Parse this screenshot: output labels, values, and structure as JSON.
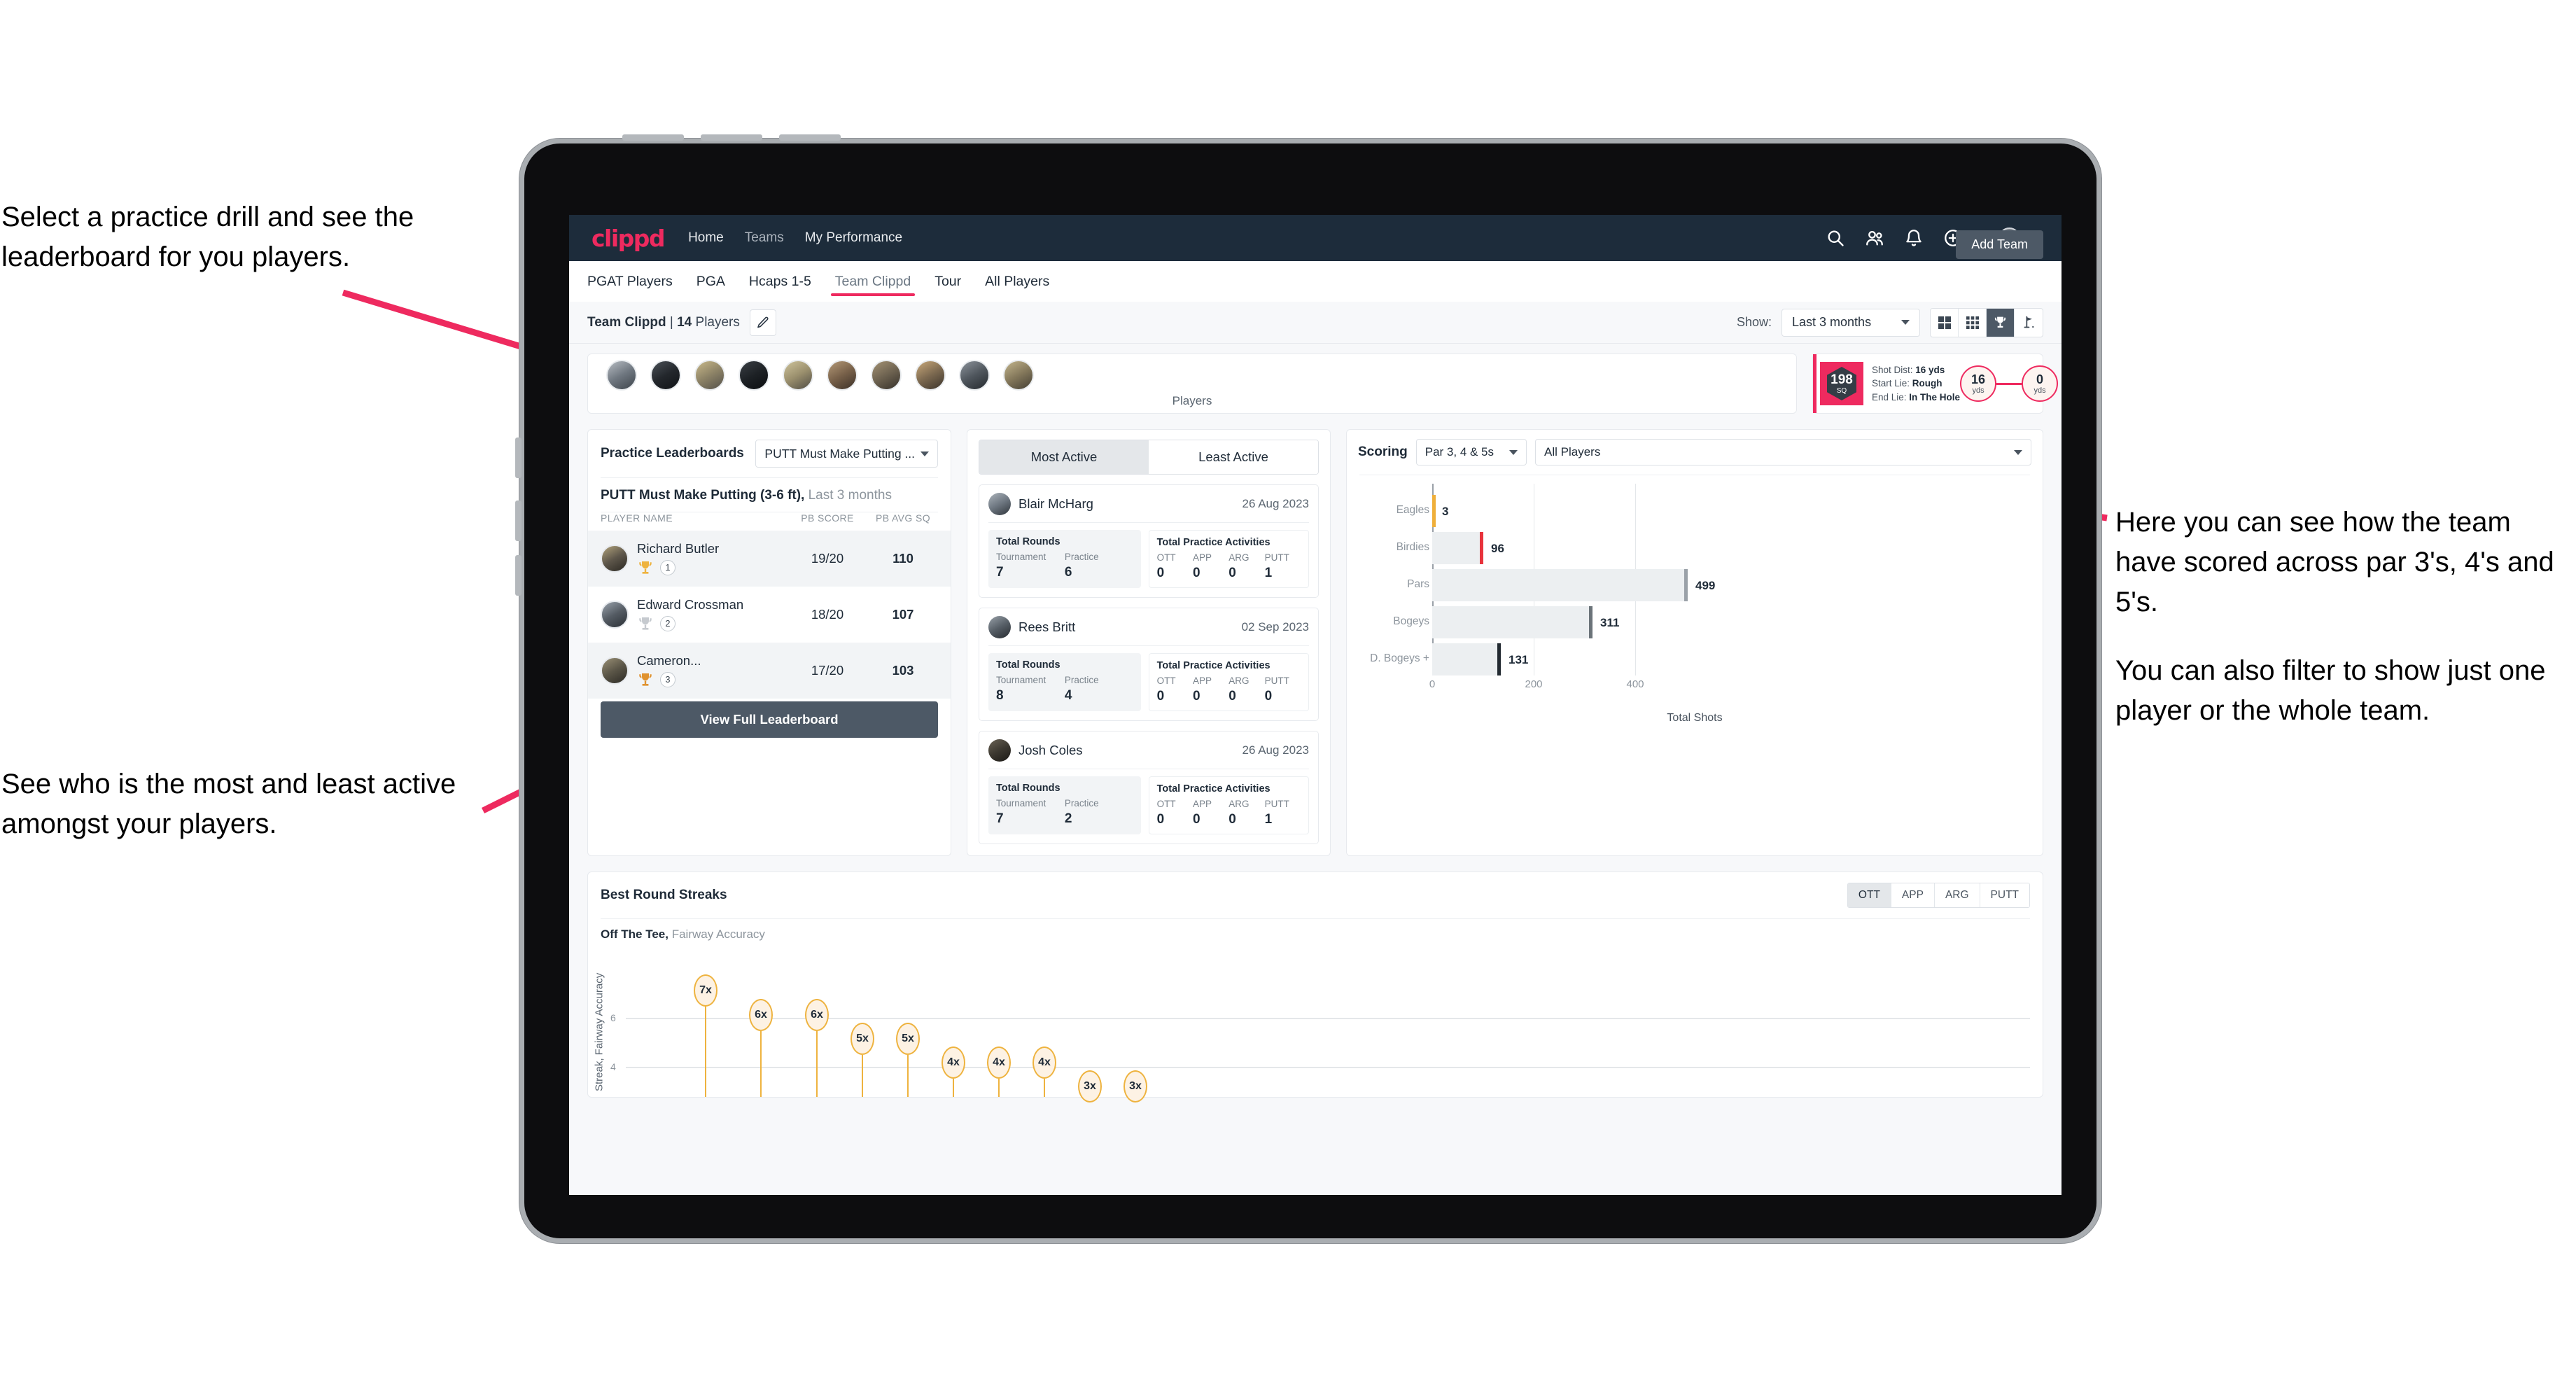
{
  "annotations": {
    "top_left": "Select a practice drill and see the leaderboard for you players.",
    "bottom_left": "See who is the most and least active amongst your players.",
    "right_1": "Here you can see how the team have scored across par 3's, 4's and 5's.",
    "right_2": "You can also filter to show just one player or the whole team."
  },
  "app": {
    "logo": "clippd",
    "nav": [
      {
        "label": "Home",
        "dim": false
      },
      {
        "label": "Teams",
        "dim": true
      },
      {
        "label": "My Performance",
        "dim": false
      }
    ],
    "header_icons": [
      "search-icon",
      "people-icon",
      "bell-icon",
      "plus-circle-icon",
      "avatar"
    ]
  },
  "tabs": [
    {
      "label": "PGAT Players",
      "active": false
    },
    {
      "label": "PGA",
      "active": false
    },
    {
      "label": "Hcaps 1-5",
      "active": false
    },
    {
      "label": "Team Clippd",
      "active": true
    },
    {
      "label": "Tour",
      "active": false
    },
    {
      "label": "All Players",
      "active": false
    }
  ],
  "add_team_button": "Add Team",
  "subbar": {
    "team_name": "Team Clippd",
    "separator": " | ",
    "player_count": "14",
    "players_word": " Players",
    "edit_icon": "pencil-icon",
    "show_label": "Show:",
    "period_value": "Last 3 months",
    "view_buttons": [
      "grid-large-icon",
      "grid-small-icon",
      "trophy-icon",
      "flag-icon"
    ],
    "active_view_index": 2
  },
  "players_card": {
    "caption": "Players",
    "avatar_count": 10
  },
  "shot_card": {
    "sq_value": "198",
    "sq_label": "SQ",
    "lines": [
      {
        "label": "Shot Dist: ",
        "value": "16 yds"
      },
      {
        "label": "Start Lie: ",
        "value": "Rough"
      },
      {
        "label": "End Lie: ",
        "value": "In The Hole"
      }
    ],
    "start_dist": {
      "value": "16",
      "unit": "yds"
    },
    "end_dist": {
      "value": "0",
      "unit": "yds"
    }
  },
  "leaderboard": {
    "title": "Practice Leaderboards",
    "drill_select": "PUTT Must Make Putting ...",
    "subtitle_bold": "PUTT Must Make Putting (3-6 ft),",
    "subtitle_rest": " Last 3 months",
    "columns": [
      "PLAYER NAME",
      "PB SCORE",
      "PB AVG SQ"
    ],
    "rows": [
      {
        "name": "Richard Butler",
        "rank": "1",
        "trophy": "gold",
        "pb_score": "19/20",
        "pb_avg_sq": "110"
      },
      {
        "name": "Edward Crossman",
        "rank": "2",
        "trophy": "silver",
        "pb_score": "18/20",
        "pb_avg_sq": "107"
      },
      {
        "name": "Cameron...",
        "rank": "3",
        "trophy": "bronze",
        "pb_score": "17/20",
        "pb_avg_sq": "103"
      }
    ],
    "view_full_button": "View Full Leaderboard"
  },
  "activity": {
    "segments": [
      {
        "label": "Most Active",
        "active": true
      },
      {
        "label": "Least Active",
        "active": false
      }
    ],
    "rounds_title": "Total Rounds",
    "practice_title": "Total Practice Activities",
    "rounds_keys": [
      "Tournament",
      "Practice"
    ],
    "practice_keys": [
      "OTT",
      "APP",
      "ARG",
      "PUTT"
    ],
    "cards": [
      {
        "name": "Blair McHarg",
        "date": "26 Aug 2023",
        "rounds": [
          "7",
          "6"
        ],
        "practice": [
          "0",
          "0",
          "0",
          "1"
        ]
      },
      {
        "name": "Rees Britt",
        "date": "02 Sep 2023",
        "rounds": [
          "8",
          "4"
        ],
        "practice": [
          "0",
          "0",
          "0",
          "0"
        ]
      },
      {
        "name": "Josh Coles",
        "date": "26 Aug 2023",
        "rounds": [
          "7",
          "2"
        ],
        "practice": [
          "0",
          "0",
          "0",
          "1"
        ]
      }
    ]
  },
  "scoring": {
    "title": "Scoring",
    "par_filter": "Par 3, 4 & 5s",
    "player_filter": "All Players"
  },
  "streaks": {
    "title": "Best Round Streaks",
    "segments": [
      {
        "label": "OTT",
        "active": true
      },
      {
        "label": "APP",
        "active": false
      },
      {
        "label": "ARG",
        "active": false
      },
      {
        "label": "PUTT",
        "active": false
      }
    ],
    "subtitle_bold": "Off The Tee,",
    "subtitle_rest": " Fairway Accuracy"
  },
  "chart_data": [
    {
      "type": "bar",
      "orientation": "horizontal",
      "title": "Scoring",
      "categories": [
        "Eagles",
        "Birdies",
        "Pars",
        "Bogeys",
        "D. Bogeys +"
      ],
      "values": [
        3,
        96,
        499,
        311,
        131
      ],
      "cap_colors": [
        "#efaf3a",
        "#e8333c",
        "#9aa1a8",
        "#6b7379",
        "#222a31"
      ],
      "xlabel": "Total Shots",
      "ylabel": "",
      "xlim": [
        0,
        540
      ],
      "xticks": [
        0,
        200,
        400
      ],
      "grid": true,
      "legend": "none"
    },
    {
      "type": "lollipop",
      "title": "Best Round Streaks",
      "subtitle": "Off The Tee, Fairway Accuracy",
      "ylabel": "Streak, Fairway Accuracy",
      "xlabel": "",
      "ylim": [
        0,
        7.6
      ],
      "yticks": [
        4,
        6
      ],
      "grid": true,
      "values": [
        7,
        6,
        6,
        5,
        5,
        4,
        4,
        4,
        3,
        3
      ],
      "labels": [
        "7x",
        "6x",
        "6x",
        "5x",
        "5x",
        "4x",
        "4x",
        "4x",
        "3x",
        "3x"
      ],
      "categories": [
        "",
        "",
        "",
        "",
        "",
        "",
        "",
        "",
        "",
        ""
      ]
    }
  ]
}
